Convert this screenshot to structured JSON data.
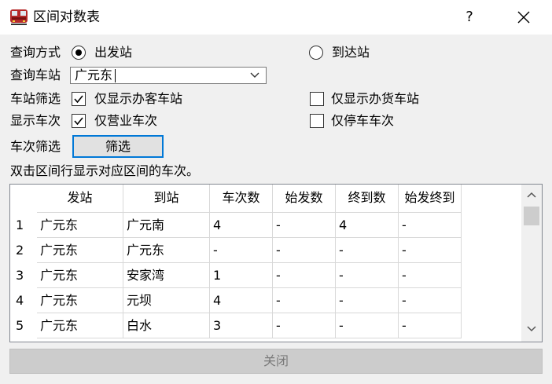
{
  "window": {
    "title": "区间对数表",
    "help_label": "?"
  },
  "query": {
    "mode_label": "查询方式",
    "mode_departure": "出发站",
    "mode_arrival": "到达站",
    "station_label": "查询车站",
    "station_value": "广元东"
  },
  "station_filter": {
    "label": "车站筛选",
    "passenger_only": "仅显示办客车站",
    "freight_only": "仅显示办货车站"
  },
  "train_display": {
    "label": "显示车次",
    "operating_only": "仅营业车次",
    "stopping_only": "仅停车车次"
  },
  "train_filter": {
    "label": "车次筛选",
    "button": "筛选"
  },
  "hint": "双击区间行显示对应区间的车次。",
  "table": {
    "headers": [
      "发站",
      "到站",
      "车次数",
      "始发数",
      "终到数",
      "始发终到"
    ],
    "rows": [
      {
        "num": "1",
        "cells": [
          "广元东",
          "广元南",
          "4",
          "-",
          "4",
          "-"
        ]
      },
      {
        "num": "2",
        "cells": [
          "广元东",
          "广元东",
          "-",
          "-",
          "-",
          "-"
        ]
      },
      {
        "num": "3",
        "cells": [
          "广元东",
          "安家湾",
          "1",
          "-",
          "-",
          "-"
        ]
      },
      {
        "num": "4",
        "cells": [
          "广元东",
          "元坝",
          "4",
          "-",
          "-",
          "-"
        ]
      },
      {
        "num": "5",
        "cells": [
          "广元东",
          "白水",
          "3",
          "-",
          "-",
          "-"
        ]
      }
    ]
  },
  "footer": {
    "close_label": "关闭"
  },
  "colors": {
    "focus_border": "#0078d7",
    "window_bg": "#f0f0f0"
  }
}
